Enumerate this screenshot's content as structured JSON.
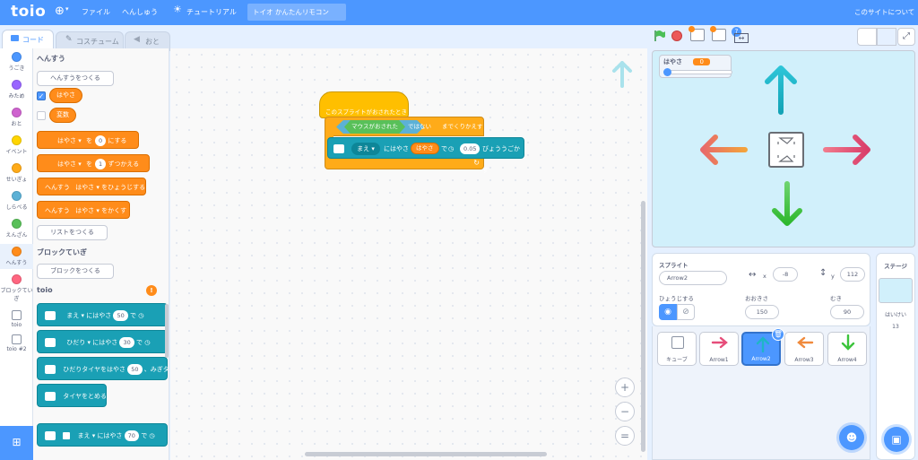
{
  "menubar": {
    "logo": "toio",
    "file": "ファイル",
    "edit": "へんしゅう",
    "tutorial": "チュートリアル",
    "project_title": "トイオ かんたんリモコン",
    "about": "このサイトについて"
  },
  "tabs": {
    "code": "コード",
    "costume": "コスチューム",
    "sound": "おと"
  },
  "categories": [
    {
      "label": "うごき",
      "color": "#4c97ff"
    },
    {
      "label": "みため",
      "color": "#9966ff"
    },
    {
      "label": "おと",
      "color": "#cf63cf"
    },
    {
      "label": "イベント",
      "color": "#ffd500"
    },
    {
      "label": "せいぎょ",
      "color": "#ffab19"
    },
    {
      "label": "しらべる",
      "color": "#5cb1d6"
    },
    {
      "label": "えんざん",
      "color": "#59c059"
    },
    {
      "label": "へんすう",
      "color": "#ff8c1a"
    },
    {
      "label": "ブロックていぎ",
      "color": "#ff6680"
    },
    {
      "label": "toio",
      "color": ""
    },
    {
      "label": "toio #2",
      "color": ""
    }
  ],
  "palette": {
    "variables_header": "へんすう",
    "make_variable": "へんすうをつくる",
    "var1": "はやさ",
    "var2": "変数",
    "set_block": {
      "prefix": "はやさ",
      "mid": "を",
      "value": "0",
      "suffix": "にする"
    },
    "change_block": {
      "prefix": "はやさ",
      "mid": "を",
      "value": "1",
      "suffix": "ずつかえる"
    },
    "show_block": {
      "prefix": "へんすう",
      "var": "はやさ",
      "suffix": "をひょうじする"
    },
    "hide_block": {
      "prefix": "へんすう",
      "var": "はやさ",
      "suffix": "をかくす"
    },
    "make_list": "リストをつくる",
    "blocks_header": "ブロックていぎ",
    "make_block": "ブロックをつくる",
    "toio_header": "toio",
    "toio_badge": "!",
    "toio_b1": {
      "dir": "まえ",
      "text": "にはやさ",
      "value": "50",
      "mid": "で"
    },
    "toio_b2": {
      "dir": "ひだり",
      "text": "にはやさ",
      "value": "30",
      "mid": "で"
    },
    "toio_b3": {
      "text": "ひだりタイヤをはやさ",
      "value": "50",
      "suffix": "、みぎタ"
    },
    "toio_b4": {
      "text": "タイヤをとめる"
    },
    "toio_b5": {
      "dir": "まえ",
      "text": "にはやさ",
      "value": "70",
      "mid": "で"
    }
  },
  "script": {
    "hat": "このスプライトがおされたとき",
    "repeat_cond_a": "マウスがおされた",
    "repeat_cond_b": "ではない",
    "repeat_suffix": "までくりかえす",
    "move_dir": "まえ",
    "move_text": "にはやさ",
    "move_var": "はやさ",
    "move_mid": "で",
    "move_value": "0.05",
    "move_suffix": "びょううごかす"
  },
  "zoom": {
    "in": "+",
    "out": "−",
    "reset": "="
  },
  "stage": {
    "monitor_label": "はやさ",
    "monitor_value": "0",
    "slider_fraction": 0.0
  },
  "sprite_info": {
    "sprite_label": "スプライト",
    "sprite_name": "Arrow2",
    "x_label": "x",
    "x_value": "-8",
    "y_label": "y",
    "y_value": "112",
    "show_label": "ひょうじする",
    "size_label": "おおきさ",
    "size_value": "150",
    "direction_label": "むき",
    "direction_value": "90"
  },
  "sprites": [
    {
      "name": "キューブ"
    },
    {
      "name": "Arrow1"
    },
    {
      "name": "Arrow2"
    },
    {
      "name": "Arrow3"
    },
    {
      "name": "Arrow4"
    }
  ],
  "stage_pane": {
    "title": "ステージ",
    "backdrops_label": "はいけい",
    "backdrops_count": "13"
  },
  "colors": {
    "menubar": "#4c97ff",
    "variables": "#ff8c1a",
    "events": "#ffbf00",
    "control": "#ffab19",
    "toio": "#1aa0b5",
    "arrow_up": "#1fb5c8",
    "arrow_right": "#e64d7a",
    "arrow_left": "#f08a3c",
    "arrow_down": "#3cc43c"
  }
}
